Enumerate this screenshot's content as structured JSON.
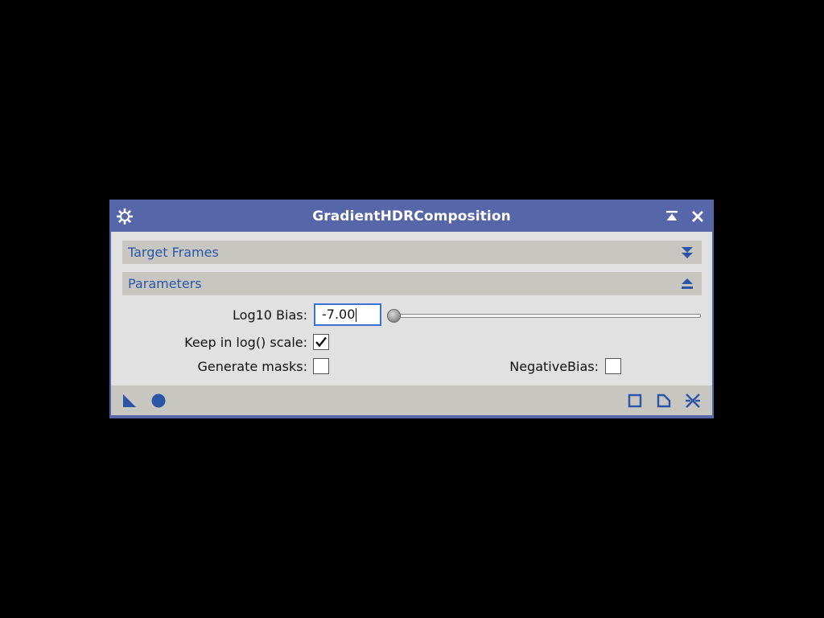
{
  "window": {
    "title": "GradientHDRComposition"
  },
  "titlebar": {
    "left_icon": "gear-icon",
    "right_icons": [
      "shade-icon",
      "close-icon"
    ]
  },
  "sections": [
    {
      "label": "Target Frames",
      "state": "collapsed",
      "icon": "double-chevron-down-icon"
    },
    {
      "label": "Parameters",
      "state": "expanded",
      "icon": "chevron-up-icon"
    }
  ],
  "parameters": {
    "log10_bias": {
      "label": "Log10 Bias:",
      "value": "-7.00",
      "slider_position": 0.0
    },
    "keep_log_scale": {
      "label": "Keep in log() scale:",
      "checked": true
    },
    "generate_masks": {
      "label": "Generate masks:",
      "checked": false
    },
    "negative_bias": {
      "label": "NegativeBias:",
      "checked": false
    }
  },
  "bottom_bar": {
    "left_icons": [
      "new-instance-icon",
      "apply-global-icon"
    ],
    "right_icons": [
      "preview-icon",
      "documentation-icon",
      "reset-icon"
    ]
  },
  "colors": {
    "titlebar": "#5666a8",
    "panel": "#e1e1e2",
    "section_bar": "#c8c6c0",
    "accent": "#2b56a8",
    "input_focus": "#3f6fd0"
  }
}
